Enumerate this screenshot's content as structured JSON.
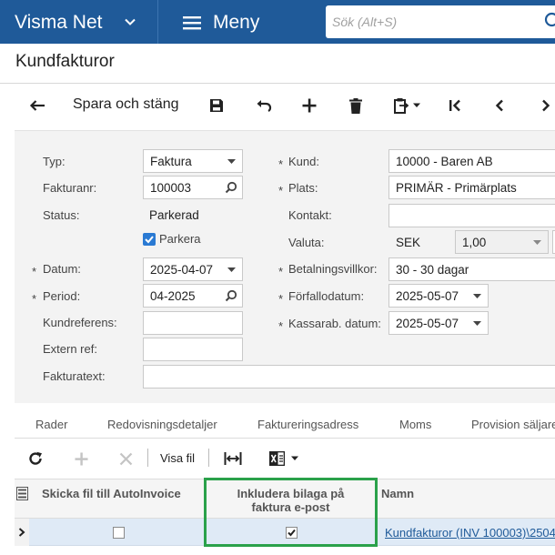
{
  "app": {
    "brand": "Visma Net",
    "menu_label": "Meny",
    "search_placeholder": "Sök (Alt+S)"
  },
  "page": {
    "title": "Kundfakturor"
  },
  "toolbar": {
    "save_close_label": "Spara och stäng"
  },
  "form": {
    "typ": {
      "label": "Typ:",
      "value": "Faktura"
    },
    "fakturanr": {
      "label": "Fakturanr:",
      "value": "100003"
    },
    "status": {
      "label": "Status:",
      "value": "Parkerad"
    },
    "parkera": {
      "label": "Parkera",
      "checked": true
    },
    "datum": {
      "label": "Datum:",
      "value": "2025-04-07"
    },
    "period": {
      "label": "Period:",
      "value": "04-2025"
    },
    "kundreferens": {
      "label": "Kundreferens:",
      "value": ""
    },
    "extern_ref": {
      "label": "Extern ref:",
      "value": ""
    },
    "fakturatext": {
      "label": "Fakturatext:",
      "value": ""
    },
    "kund": {
      "label": "Kund:",
      "value": "10000 -  Baren AB"
    },
    "plats": {
      "label": "Plats:",
      "value": "PRIMÄR - Primärplats"
    },
    "kontakt": {
      "label": "Kontakt:",
      "value": ""
    },
    "valuta": {
      "label": "Valuta:",
      "currency": "SEK",
      "rate": "1,00"
    },
    "betalningsvillkor": {
      "label": "Betalningsvillkor:",
      "value": "30 - 30 dagar"
    },
    "forfallodatum": {
      "label": "Förfallodatum:",
      "value": "2025-05-07"
    },
    "kassarab_datum": {
      "label": "Kassarab. datum:",
      "value": "2025-05-07"
    },
    "required_mark": "*"
  },
  "tabs": [
    {
      "label": "Rader"
    },
    {
      "label": "Redovisningsdetaljer"
    },
    {
      "label": "Faktureringsadress"
    },
    {
      "label": "Moms"
    },
    {
      "label": "Provision säljare"
    }
  ],
  "grid": {
    "visa_fil_label": "Visa fil",
    "columns": {
      "send_file": "Skicka fil till AutoInvoice",
      "include_line1": "Inkludera bilaga på",
      "include_line2": "faktura e-post",
      "name": "Namn"
    },
    "rows": [
      {
        "send_file": false,
        "include": true,
        "name": "Kundfakturor (INV 100003)\\2504"
      }
    ]
  },
  "colors": {
    "topbar": "#1f5a99",
    "highlight": "#2aa14a",
    "row_selected": "#dfeaf6",
    "link": "#1f5a99"
  }
}
